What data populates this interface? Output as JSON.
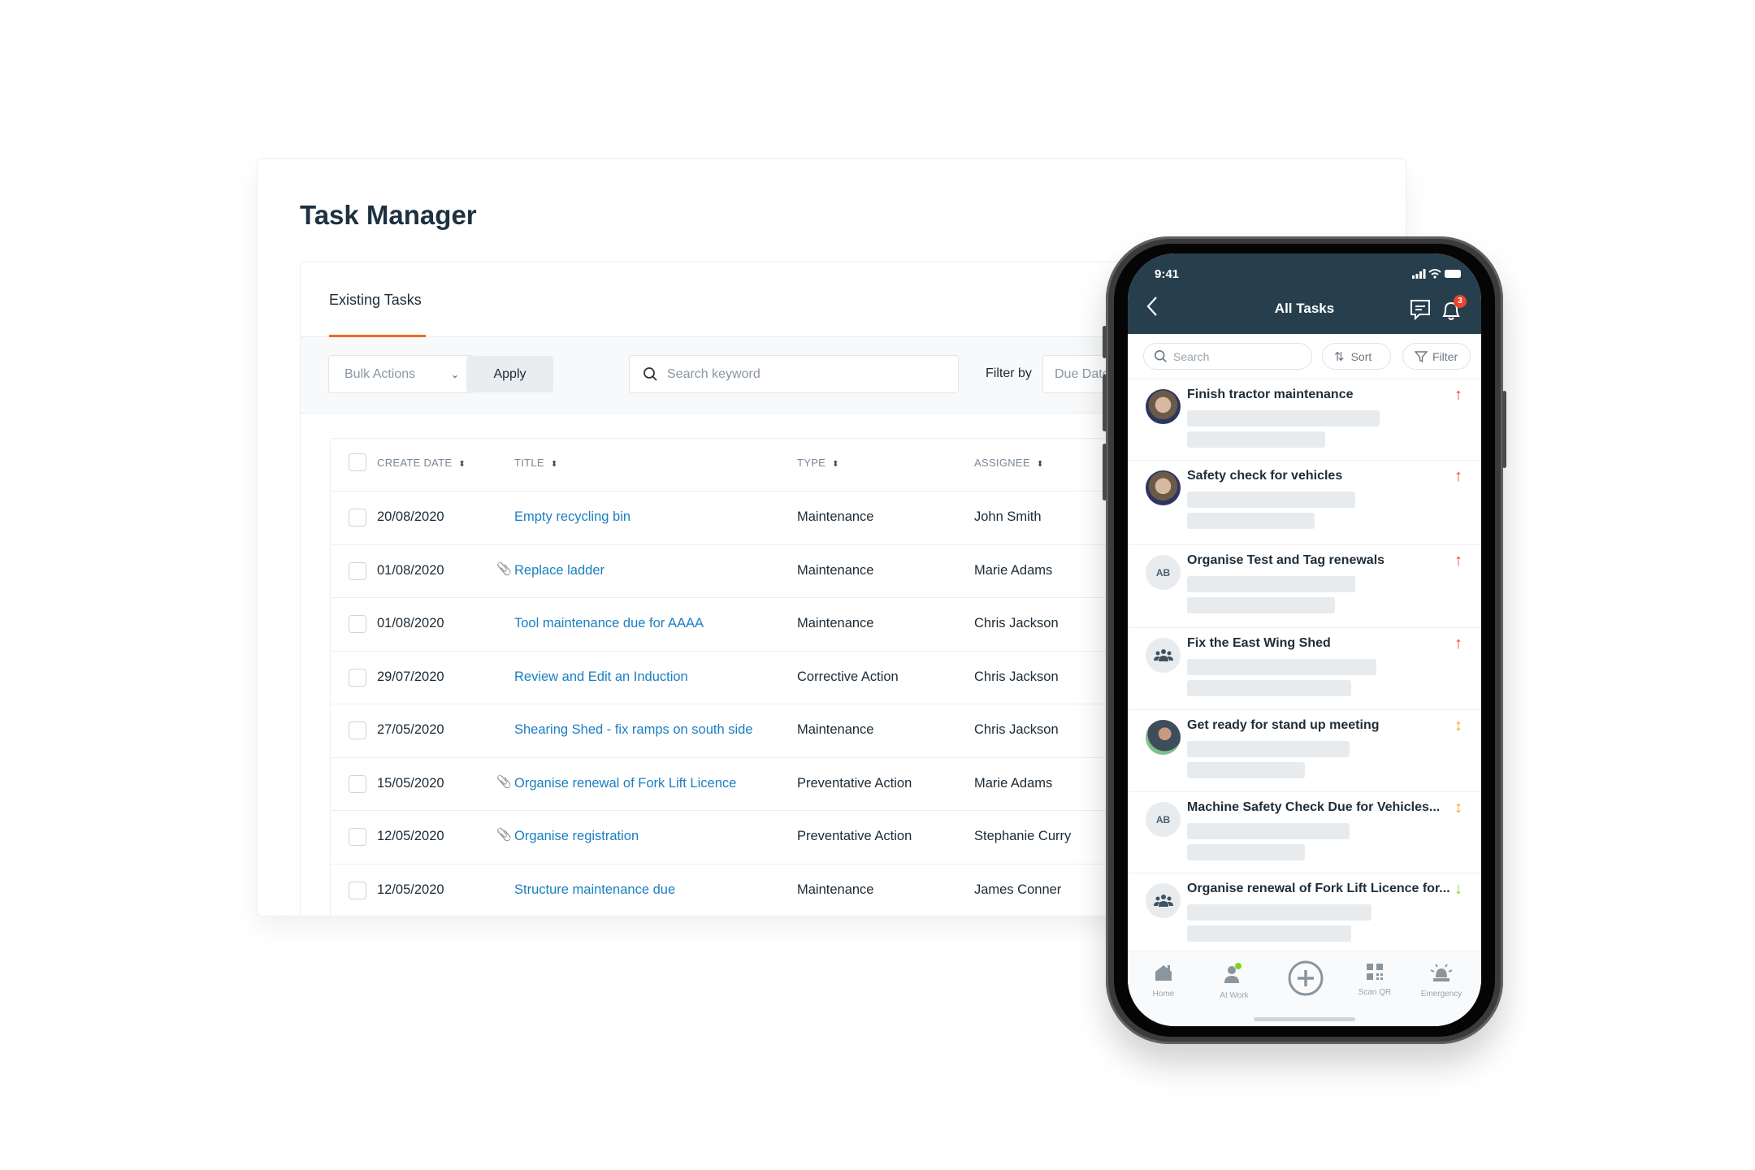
{
  "desktop": {
    "title": "Task Manager",
    "tab": "Existing Tasks",
    "toolbar": {
      "bulk_actions": "Bulk Actions",
      "apply": "Apply",
      "search_placeholder": "Search keyword",
      "filter_by": "Filter by",
      "filter_value": "Due Date"
    },
    "columns": [
      "CREATE DATE",
      "TITLE",
      "TYPE",
      "ASSIGNEE"
    ],
    "rows": [
      {
        "date": "20/08/2020",
        "title": "Empty recycling bin",
        "type": "Maintenance",
        "assignee": "John Smith",
        "attachment": false
      },
      {
        "date": "01/08/2020",
        "title": "Replace ladder",
        "type": "Maintenance",
        "assignee": "Marie Adams",
        "attachment": true
      },
      {
        "date": "01/08/2020",
        "title": "Tool maintenance due for AAAA",
        "type": "Maintenance",
        "assignee": "Chris Jackson",
        "attachment": false
      },
      {
        "date": "29/07/2020",
        "title": "Review and Edit an Induction",
        "type": "Corrective Action",
        "assignee": "Chris Jackson",
        "attachment": false
      },
      {
        "date": "27/05/2020",
        "title": "Shearing Shed - fix ramps on south side",
        "type": "Maintenance",
        "assignee": "Chris Jackson",
        "attachment": false
      },
      {
        "date": "15/05/2020",
        "title": "Organise renewal of Fork Lift Licence",
        "type": "Preventative Action",
        "assignee": "Marie Adams",
        "attachment": true
      },
      {
        "date": "12/05/2020",
        "title": "Organise registration",
        "type": "Preventative Action",
        "assignee": "Stephanie Curry",
        "attachment": true
      },
      {
        "date": "12/05/2020",
        "title": "Structure maintenance due",
        "type": "Maintenance",
        "assignee": "James Conner",
        "attachment": false
      }
    ],
    "accent": "#f26a1b",
    "link_color": "#1a7fc1"
  },
  "mobile": {
    "time": "9:41",
    "title": "All Tasks",
    "notification_count": "3",
    "search_placeholder": "Search",
    "sort": "Sort",
    "filter": "Filter",
    "header_color": "#273f4c",
    "priority_colors": {
      "high": "#e8452c",
      "medium": "#f5a623",
      "low": "#7ed321"
    },
    "tasks": [
      {
        "title": "Finish tractor maintenance",
        "avatar": "photo",
        "priority": "high"
      },
      {
        "title": "Safety check for vehicles",
        "avatar": "photo",
        "priority": "high"
      },
      {
        "title": "Organise Test and Tag renewals",
        "avatar": "AB",
        "priority": "high"
      },
      {
        "title": "Fix the East Wing Shed",
        "avatar": "group",
        "priority": "high"
      },
      {
        "title": "Get ready for stand up meeting",
        "avatar": "photo",
        "priority": "medium"
      },
      {
        "title": "Machine Safety Check Due for Vehicles...",
        "avatar": "AB",
        "priority": "medium"
      },
      {
        "title": "Organise renewal of Fork Lift Licence for...",
        "avatar": "group",
        "priority": "low"
      }
    ],
    "nav": [
      {
        "label": "Home",
        "icon": "home-icon"
      },
      {
        "label": "At Work",
        "icon": "person-icon"
      },
      {
        "label": "",
        "icon": "plus-circle-icon"
      },
      {
        "label": "Scan QR",
        "icon": "qr-icon"
      },
      {
        "label": "Emergency",
        "icon": "siren-icon"
      }
    ]
  }
}
